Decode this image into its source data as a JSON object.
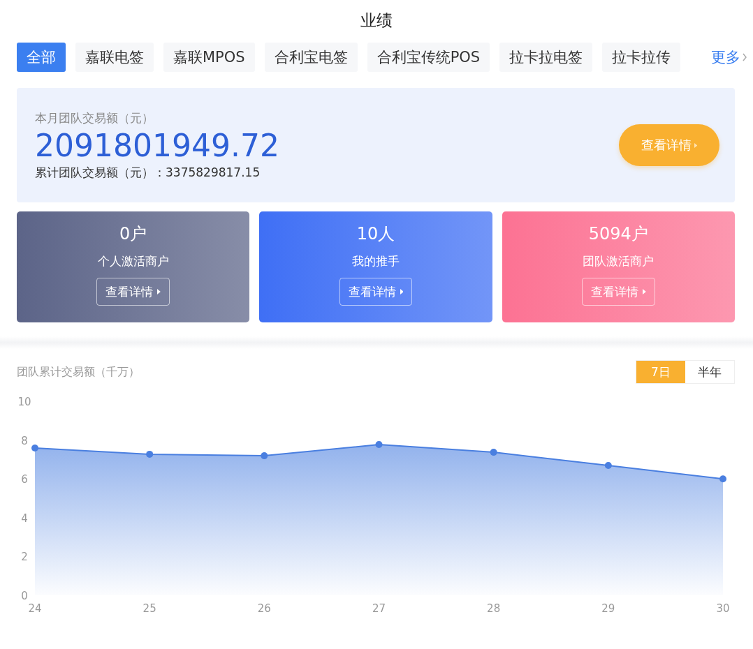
{
  "title": "业绩",
  "tabs": [
    {
      "label": "全部",
      "selected": true
    },
    {
      "label": "嘉联电签",
      "selected": false
    },
    {
      "label": "嘉联MPOS",
      "selected": false
    },
    {
      "label": "合利宝电签",
      "selected": false
    },
    {
      "label": "合利宝传统POS",
      "selected": false
    },
    {
      "label": "拉卡拉电签",
      "selected": false
    },
    {
      "label": "拉卡拉传",
      "selected": false
    }
  ],
  "more": "更多",
  "summary": {
    "label": "本月团队交易额（元）",
    "amount": "2091801949.72",
    "total_label": "累计团队交易额（元）：",
    "total": "3375829817.15",
    "button": "查看详情"
  },
  "stats": [
    {
      "value": "0户",
      "label": "个人激活商户",
      "button": "查看详情",
      "color": "#5c6488"
    },
    {
      "value": "10人",
      "label": "我的推手",
      "button": "查看详情",
      "color": "#3f6ff5"
    },
    {
      "value": "5094户",
      "label": "团队激活商户",
      "button": "查看详情",
      "color": "#fc7293"
    }
  ],
  "chart": {
    "title": "团队累计交易额（千万）",
    "ranges": [
      {
        "label": "7日",
        "selected": true
      },
      {
        "label": "半年",
        "selected": false
      }
    ],
    "chart_data": {
      "type": "area",
      "categories": [
        "24",
        "25",
        "26",
        "27",
        "28",
        "29",
        "30"
      ],
      "series": [
        {
          "color": "#4a7fe0",
          "values": [
            7.59,
            7.27,
            7.19,
            7.77,
            7.37,
            6.69,
            6.0
          ]
        }
      ],
      "ylim": [
        0,
        10
      ],
      "yticks": [
        0,
        2,
        4,
        6,
        8,
        10
      ]
    }
  }
}
